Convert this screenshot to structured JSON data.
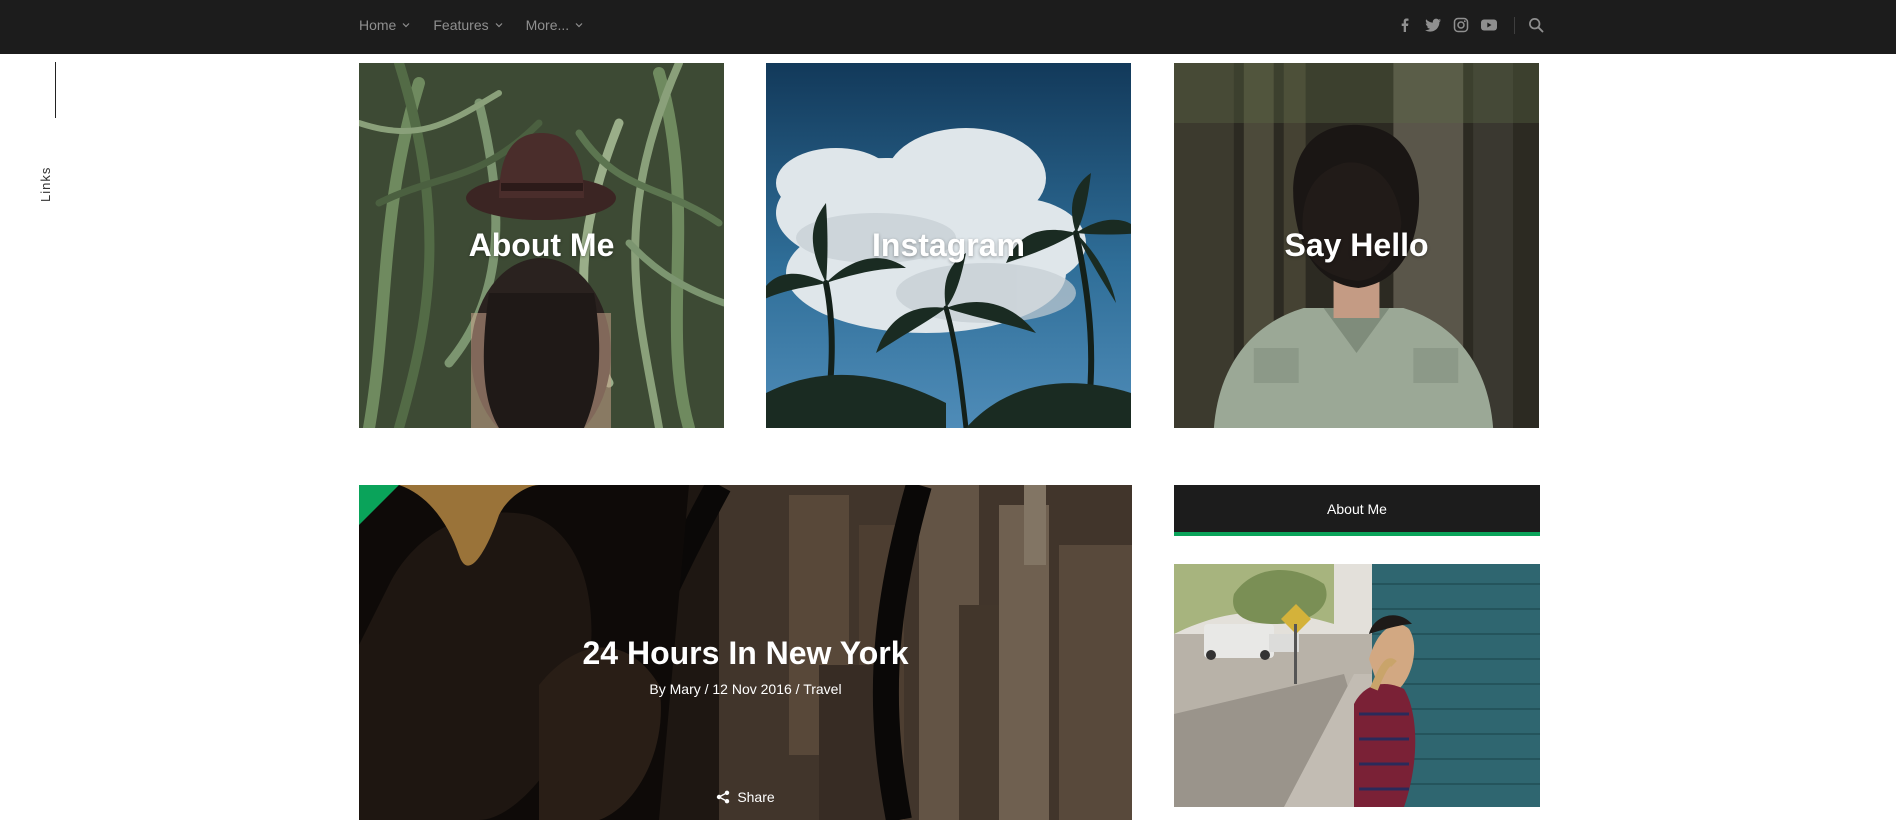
{
  "nav": {
    "items": [
      {
        "label": "Home"
      },
      {
        "label": "Features"
      },
      {
        "label": "More..."
      }
    ]
  },
  "social": {
    "icons": [
      "facebook-icon",
      "twitter-icon",
      "instagram-icon",
      "youtube-icon"
    ],
    "search_icon": "search-icon"
  },
  "side": {
    "label": "Links"
  },
  "tiles": [
    {
      "title": "About Me"
    },
    {
      "title": "Instagram"
    },
    {
      "title": "Say Hello"
    }
  ],
  "featured": {
    "title": "24 Hours In New York",
    "meta": "By Mary / 12 Nov 2016 / Travel",
    "share_label": "Share"
  },
  "sidebar": {
    "widget_title": "About Me"
  },
  "colors": {
    "topbar": "#1c1c1c",
    "accent": "#0aa35a",
    "nav_text": "#8f8f8f"
  }
}
